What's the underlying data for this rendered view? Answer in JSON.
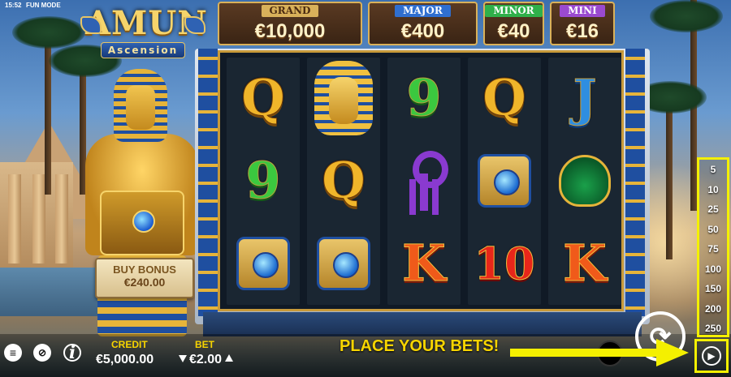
{
  "status": {
    "time": "15:52",
    "mode": "FUN MODE"
  },
  "logo": {
    "title": "AMUN",
    "subtitle": "Ascension"
  },
  "jackpots": [
    {
      "name": "GRAND",
      "value": "€10,000",
      "color": "#d9b15a"
    },
    {
      "name": "MAJOR",
      "value": "€400",
      "color": "#2f6fd0"
    },
    {
      "name": "MINOR",
      "value": "€40",
      "color": "#2fb04a"
    },
    {
      "name": "MINI",
      "value": "€16",
      "color": "#9a4ad0"
    }
  ],
  "buy_bonus": {
    "label": "BUY BONUS",
    "price": "€240.00"
  },
  "reels": [
    [
      "Q",
      "9",
      "eye"
    ],
    [
      "pharaoh-mask",
      "Q",
      "eye"
    ],
    [
      "9",
      "ankh",
      "K"
    ],
    [
      "Q",
      "eye",
      "10"
    ],
    [
      "J",
      "scarab",
      "K"
    ]
  ],
  "hud": {
    "credit_label": "CREDIT",
    "credit_value": "€5,000.00",
    "bet_label": "BET",
    "bet_value": "€2.00",
    "message": "PLACE YOUR BETS!"
  },
  "icons": {
    "menu": "menu-icon",
    "sound": "sound-off-icon",
    "info": "info-icon",
    "spin": "spin-icon",
    "autoplay": "autoplay-icon"
  },
  "autoplay": {
    "options": [
      "5",
      "10",
      "25",
      "50",
      "75",
      "100",
      "150",
      "200",
      "250"
    ]
  },
  "colors": {
    "accent": "#f7d400",
    "highlight": "#f4f000"
  }
}
